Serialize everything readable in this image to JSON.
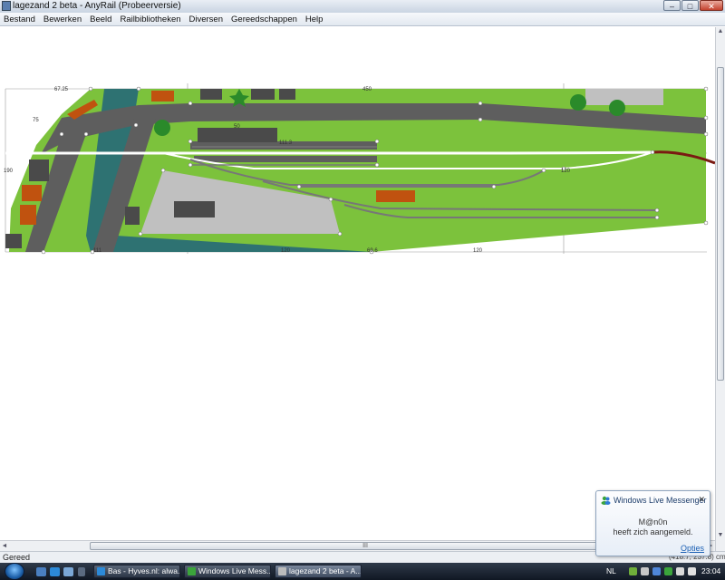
{
  "window": {
    "title": "lagezand 2 beta - AnyRail (Probeerversie)",
    "min": "–",
    "max": "□",
    "close": "✕"
  },
  "menu": [
    "Bestand",
    "Bewerken",
    "Beeld",
    "Railbibliotheken",
    "Diversen",
    "Gereedschappen",
    "Help"
  ],
  "layout": {
    "dims": [
      "67.25",
      "450",
      "75",
      "50",
      "111.3",
      "120",
      "120",
      "190",
      "69.6",
      "120",
      "111"
    ],
    "colors": {
      "baseboard": "#7cc23c",
      "road": "#5e5e5e",
      "water": "#2e7272",
      "platform": "#c0c0c0",
      "building": "#4a4a4a",
      "house_roof": "#c0520f",
      "tree": "#2a8a2a",
      "track_mainline": "#ffffff",
      "track_old": "#7a1a12"
    }
  },
  "status": {
    "text": "Gereed",
    "coords": "(418.7, 237.8) cm"
  },
  "notification": {
    "title": "Windows Live Messenger",
    "user": "M@n0n",
    "message": "heeft zich aangemeld.",
    "link": "Opties",
    "close": "✕"
  },
  "taskbar": {
    "buttons": [
      "Bas - Hyves.nl: alwa...",
      "Windows Live Mess...",
      "lagezand 2 beta - A..."
    ],
    "lang": "NL",
    "clock": "23:04"
  },
  "scroll": {
    "grip": "III",
    "up": "▲",
    "down": "▼",
    "left": "◄",
    "right": "►"
  }
}
